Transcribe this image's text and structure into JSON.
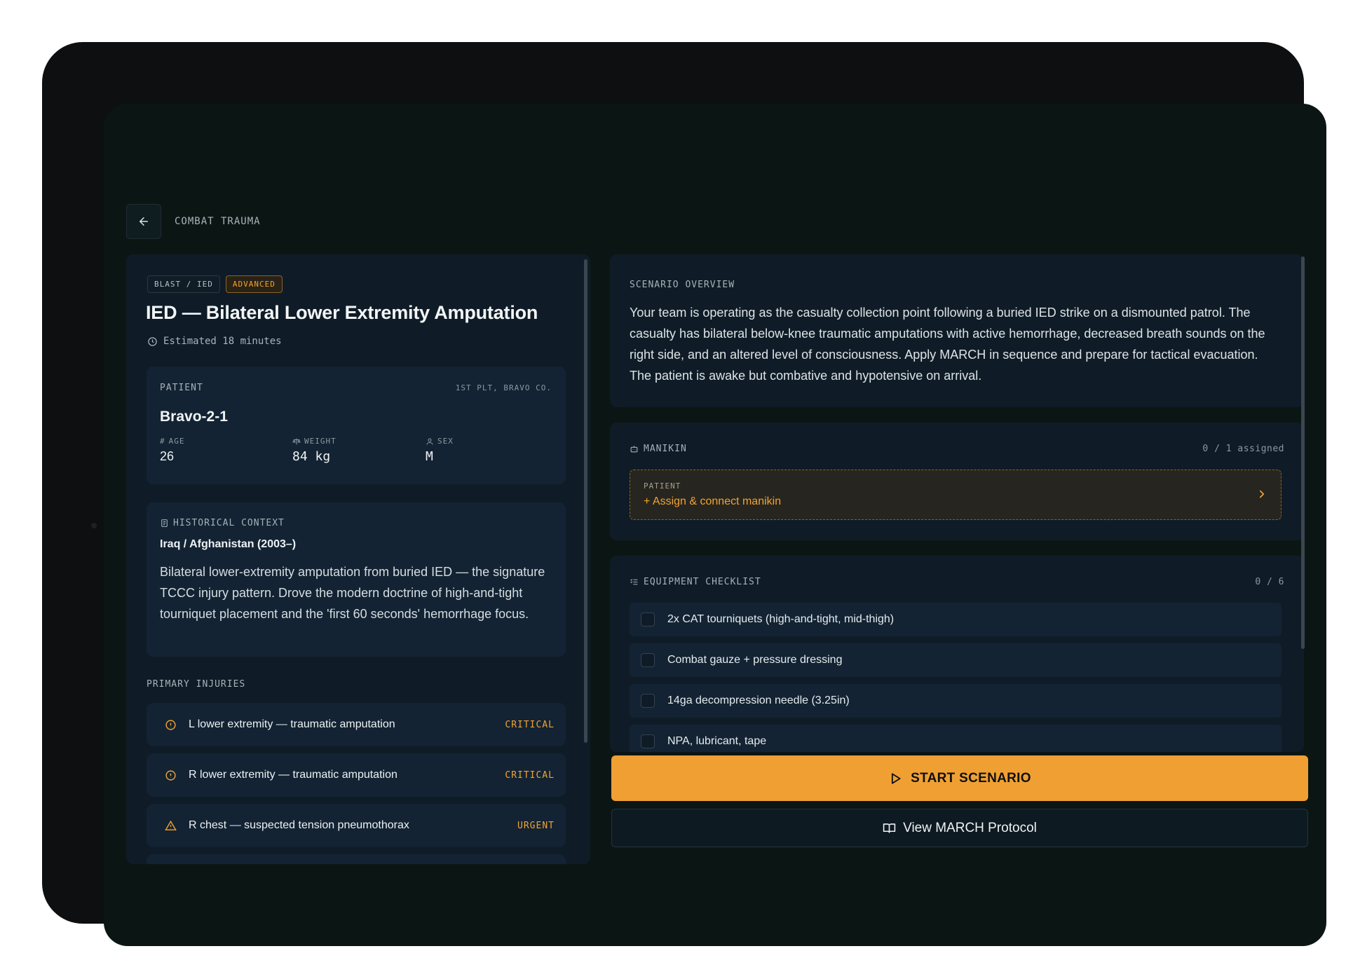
{
  "header": {
    "breadcrumb": "COMBAT TRAUMA"
  },
  "scenario": {
    "tags": [
      "BLAST / IED",
      "ADVANCED"
    ],
    "title": "IED — Bilateral Lower Extremity Amputation",
    "estimate": "Estimated 18 minutes"
  },
  "patient": {
    "label": "PATIENT",
    "unit": "1ST PLT, BRAVO CO.",
    "name": "Bravo-2-1",
    "stats": [
      {
        "label": "AGE",
        "value": "26"
      },
      {
        "label": "WEIGHT",
        "value": "84 kg"
      },
      {
        "label": "SEX",
        "value": "M"
      }
    ]
  },
  "history": {
    "label": "HISTORICAL CONTEXT",
    "era": "Iraq / Afghanistan (2003–)",
    "text": "Bilateral lower-extremity amputation from buried IED — the signature TCCC injury pattern. Drove the modern doctrine of high-and-tight tourniquet placement and the 'first 60 seconds' hemorrhage focus."
  },
  "injuries": {
    "label": "PRIMARY INJURIES",
    "items": [
      {
        "text": "L lower extremity — traumatic amputation",
        "severity": "CRITICAL",
        "icon": "alert-circle-icon"
      },
      {
        "text": "R lower extremity — traumatic amputation",
        "severity": "CRITICAL",
        "icon": "alert-circle-icon"
      },
      {
        "text": "R chest — suspected tension pneumothorax",
        "severity": "URGENT",
        "icon": "alert-triangle-icon"
      }
    ]
  },
  "overview": {
    "label": "SCENARIO OVERVIEW",
    "text": "Your team is operating as the casualty collection point following a buried IED strike on a dismounted patrol. The casualty has bilateral below-knee traumatic amputations with active hemorrhage, decreased breath sounds on the right side, and an altered level of consciousness. Apply MARCH in sequence and prepare for tactical evacuation. The patient is awake but combative and hypotensive on arrival."
  },
  "manikin": {
    "label": "MANIKIN",
    "count": "0 / 1 assigned",
    "slot_label": "PATIENT",
    "action": "+  Assign & connect manikin"
  },
  "equipment": {
    "label": "EQUIPMENT CHECKLIST",
    "count": "0 / 6",
    "items": [
      "2x CAT tourniquets (high-and-tight, mid-thigh)",
      "Combat gauze + pressure dressing",
      "14ga decompression needle (3.25in)",
      "NPA, lubricant, tape"
    ]
  },
  "actions": {
    "start": "START SCENARIO",
    "protocol": "View MARCH Protocol"
  },
  "colors": {
    "accent": "#f0a033",
    "panel": "#0f1c27",
    "background": "#0b1614"
  }
}
